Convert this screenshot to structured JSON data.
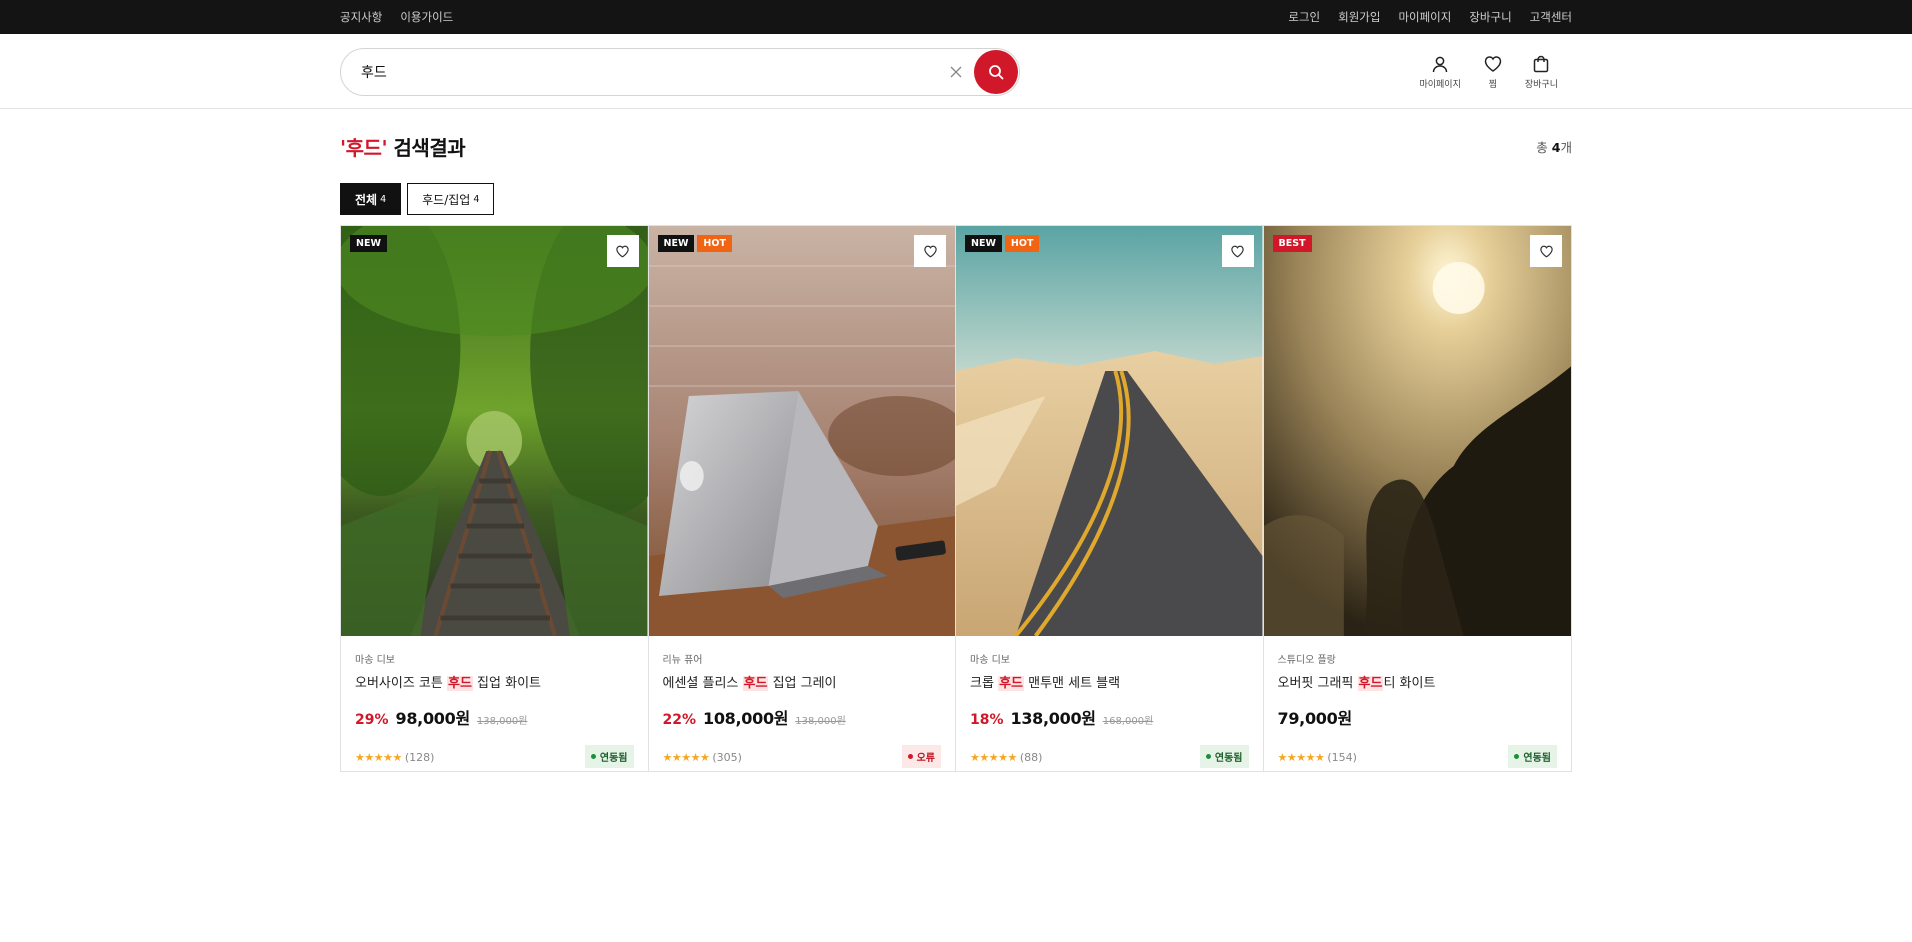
{
  "topbar": {
    "left": [
      "공지사항",
      "이용가이드"
    ],
    "right": [
      "로그인",
      "회원가입",
      "마이페이지",
      "장바구니",
      "고객센터"
    ]
  },
  "search": {
    "value": "후드",
    "placeholder": ""
  },
  "header_icons": [
    {
      "label": "마이페이지",
      "icon": "user-icon"
    },
    {
      "label": "찜",
      "icon": "heart-icon"
    },
    {
      "label": "장바구니",
      "icon": "bag-icon"
    }
  ],
  "result": {
    "quote_open": "'",
    "keyword": "후드",
    "quote_close": "'",
    "title_suffix": " 검색결과",
    "total_prefix": "총 ",
    "total_count": "4",
    "total_suffix": "개"
  },
  "tabs": [
    {
      "label": "전체",
      "count": "4",
      "active": true
    },
    {
      "label": "후드/집업",
      "count": "4",
      "active": false
    }
  ],
  "products": [
    {
      "badges": [
        {
          "text": "NEW",
          "type": "new"
        }
      ],
      "image": "forest-railway",
      "brand": "마송 디보",
      "name_before": "오버사이즈 코튼 ",
      "name_highlight": "후드",
      "name_after": " 집업 화이트",
      "discount": "29%",
      "price": "98,000원",
      "original": "138,000원",
      "stars": "★★★★★",
      "reviews": "(128)",
      "status": {
        "text": "연동됨",
        "type": "ok"
      }
    },
    {
      "badges": [
        {
          "text": "NEW",
          "type": "new"
        },
        {
          "text": "HOT",
          "type": "hot"
        }
      ],
      "image": "laptop-desk",
      "brand": "리뉴 퓨어",
      "name_before": "에센셜 플리스 ",
      "name_highlight": "후드",
      "name_after": " 집업 그레이",
      "discount": "22%",
      "price": "108,000원",
      "original": "138,000원",
      "stars": "★★★★★",
      "reviews": "(305)",
      "status": {
        "text": "오류",
        "type": "err"
      }
    },
    {
      "badges": [
        {
          "text": "NEW",
          "type": "new"
        },
        {
          "text": "HOT",
          "type": "hot"
        }
      ],
      "image": "desert-road",
      "brand": "마송 디보",
      "name_before": "크롭 ",
      "name_highlight": "후드",
      "name_after": " 맨투맨 세트 블랙",
      "discount": "18%",
      "price": "138,000원",
      "original": "168,000원",
      "stars": "★★★★★",
      "reviews": "(88)",
      "status": {
        "text": "연동됨",
        "type": "ok"
      }
    },
    {
      "badges": [
        {
          "text": "BEST",
          "type": "best"
        }
      ],
      "image": "foggy-sunrise",
      "brand": "스튜디오 플랑",
      "name_before": "오버핏 그래픽 ",
      "name_highlight": "후드",
      "name_after": "티 화이트",
      "discount": "",
      "price": "79,000원",
      "original": "",
      "stars": "★★★★★",
      "reviews": "(154)",
      "status": {
        "text": "연동됨",
        "type": "ok"
      }
    }
  ],
  "colors": {
    "accent": "#d0182a",
    "hot": "#f06414",
    "topbar": "#141414"
  }
}
